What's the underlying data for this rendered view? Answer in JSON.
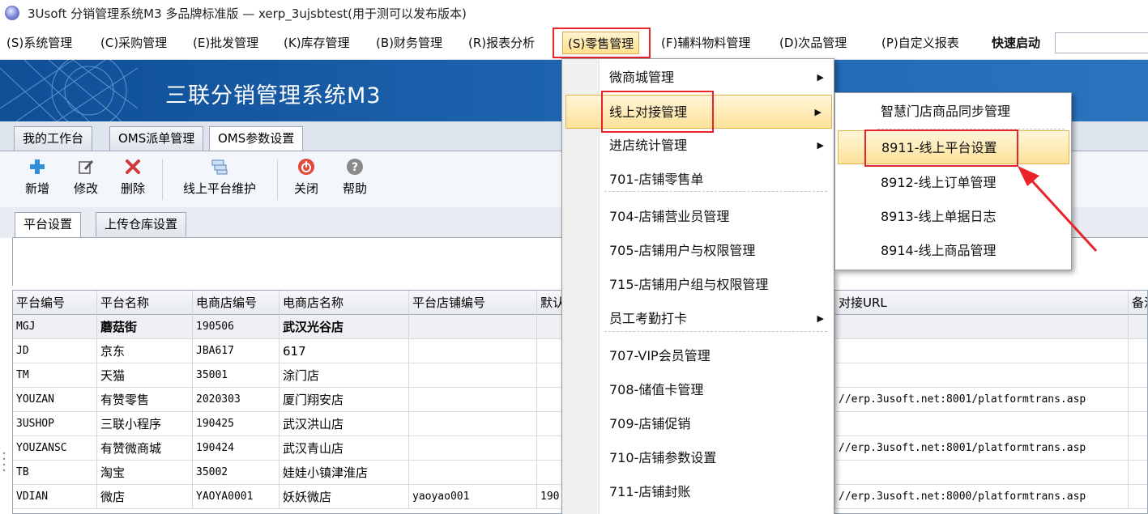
{
  "window": {
    "title": "3Usoft 分销管理系统M3 多品牌标准版 — xerp_3ujsbtest(用于测可以发布版本)"
  },
  "menubar": {
    "items": [
      "(S)系统管理",
      "(C)采购管理",
      "(E)批发管理",
      "(K)库存管理",
      "(B)财务管理",
      "(R)报表分析",
      "(S)零售管理",
      "(F)辅料物料管理",
      "(D)次品管理",
      "(P)自定义报表",
      "快速启动"
    ]
  },
  "banner": {
    "title": "三联分销管理系统M3"
  },
  "tabs": [
    "我的工作台",
    "OMS派单管理",
    "OMS参数设置"
  ],
  "toolbar": {
    "buttons": [
      "新增",
      "修改",
      "删除",
      "线上平台维护",
      "关闭",
      "帮助"
    ]
  },
  "subtabs": [
    "平台设置",
    "上传仓库设置"
  ],
  "grid": {
    "headers": [
      "平台编号",
      "平台名称",
      "电商店编号",
      "电商店名称",
      "平台店铺编号",
      "默认",
      "对接URL",
      "备注"
    ],
    "rows": [
      [
        "MGJ",
        "蘑菇街",
        "190506",
        "武汉光谷店",
        "",
        "",
        ""
      ],
      [
        "JD",
        "京东",
        "JBA617",
        "617",
        "",
        "",
        ""
      ],
      [
        "TM",
        "天猫",
        "35001",
        "涂门店",
        "",
        "",
        ""
      ],
      [
        "YOUZAN",
        "有赞零售",
        "2020303",
        "厦门翔安店",
        "",
        "",
        "//erp.3usoft.net:8001/platformtrans.asp"
      ],
      [
        "3USHOP",
        "三联小程序",
        "190425",
        "武汉洪山店",
        "",
        "",
        ""
      ],
      [
        "YOUZANSC",
        "有赞微商城",
        "190424",
        "武汉青山店",
        "",
        "",
        "//erp.3usoft.net:8001/platformtrans.asp"
      ],
      [
        "TB",
        "淘宝",
        "35002",
        "娃娃小镇津淮店",
        "",
        "",
        ""
      ],
      [
        "VDIAN",
        "微店",
        "YAOYA0001",
        "妖妖微店",
        "yaoyao001",
        "190",
        "//erp.3usoft.net:8000/platformtrans.asp"
      ]
    ]
  },
  "retail_menu": {
    "items": [
      {
        "label": "微商城管理",
        "submenu": true
      },
      {
        "label": "线上对接管理",
        "submenu": true
      },
      {
        "label": "进店统计管理",
        "submenu": true
      },
      {
        "label": "701-店铺零售单",
        "submenu": false
      },
      {
        "label": "704-店铺营业员管理",
        "submenu": false
      },
      {
        "label": "705-店铺用户与权限管理",
        "submenu": false
      },
      {
        "label": "715-店铺用户组与权限管理",
        "submenu": false
      },
      {
        "label": "员工考勤打卡",
        "submenu": true
      },
      {
        "label": "707-VIP会员管理",
        "submenu": false
      },
      {
        "label": "708-储值卡管理",
        "submenu": false
      },
      {
        "label": "709-店铺促销",
        "submenu": false
      },
      {
        "label": "710-店铺参数设置",
        "submenu": false
      },
      {
        "label": "711-店铺封账",
        "submenu": false
      }
    ]
  },
  "online_menu": {
    "items": [
      "智慧门店商品同步管理",
      "8911-线上平台设置",
      "8912-线上订单管理",
      "8913-线上单据日志",
      "8914-线上商品管理"
    ]
  },
  "colors": {
    "highlight_border": "#e8242a",
    "menu_highlight": "#fde19a",
    "banner_blue": "#1c62ad"
  }
}
